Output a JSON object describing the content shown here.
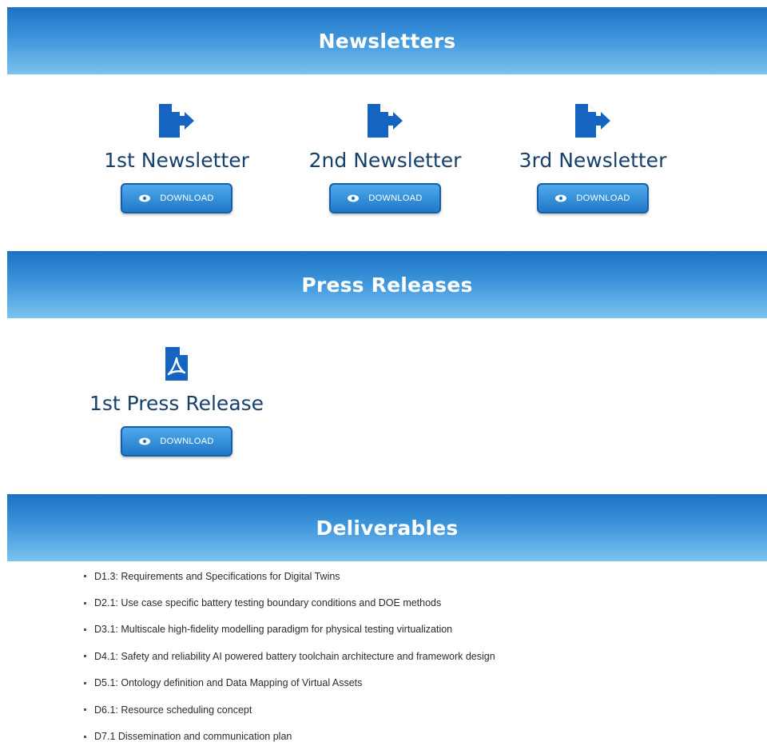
{
  "sections": {
    "newsletters": {
      "title": "Newsletters",
      "items": [
        {
          "title": "1st Newsletter",
          "button": "DOWNLOAD",
          "icon": "file-export-icon"
        },
        {
          "title": "2nd Newsletter",
          "button": "DOWNLOAD",
          "icon": "file-export-icon"
        },
        {
          "title": "3rd Newsletter",
          "button": "DOWNLOAD",
          "icon": "file-export-icon"
        }
      ]
    },
    "press": {
      "title": "Press Releases",
      "items": [
        {
          "title": "1st Press Release",
          "button": "DOWNLOAD",
          "icon": "file-pdf-icon"
        }
      ]
    },
    "deliverables": {
      "title": "Deliverables",
      "items": [
        "D1.3: Requirements and Specifications for Digital Twins",
        "D2.1: Use case specific battery testing boundary conditions and DOE methods",
        "D3.1: Multiscale high-fidelity modelling paradigm for physical testing virtualization",
        "D4.1: Safety and reliability AI powered battery toolchain architecture and framework design",
        "D5.1: Ontology definition and Data Mapping of Virtual Assets",
        "D6.1: Resource scheduling concept",
        "D7.1 Dissemination and communication plan"
      ]
    }
  },
  "colors": {
    "banner_top": "#1d72c2",
    "banner_bottom": "#7cc3ef",
    "icon_blue": "#1565c0",
    "title_navy": "#17406d",
    "button_blue": "#1f79c9"
  }
}
